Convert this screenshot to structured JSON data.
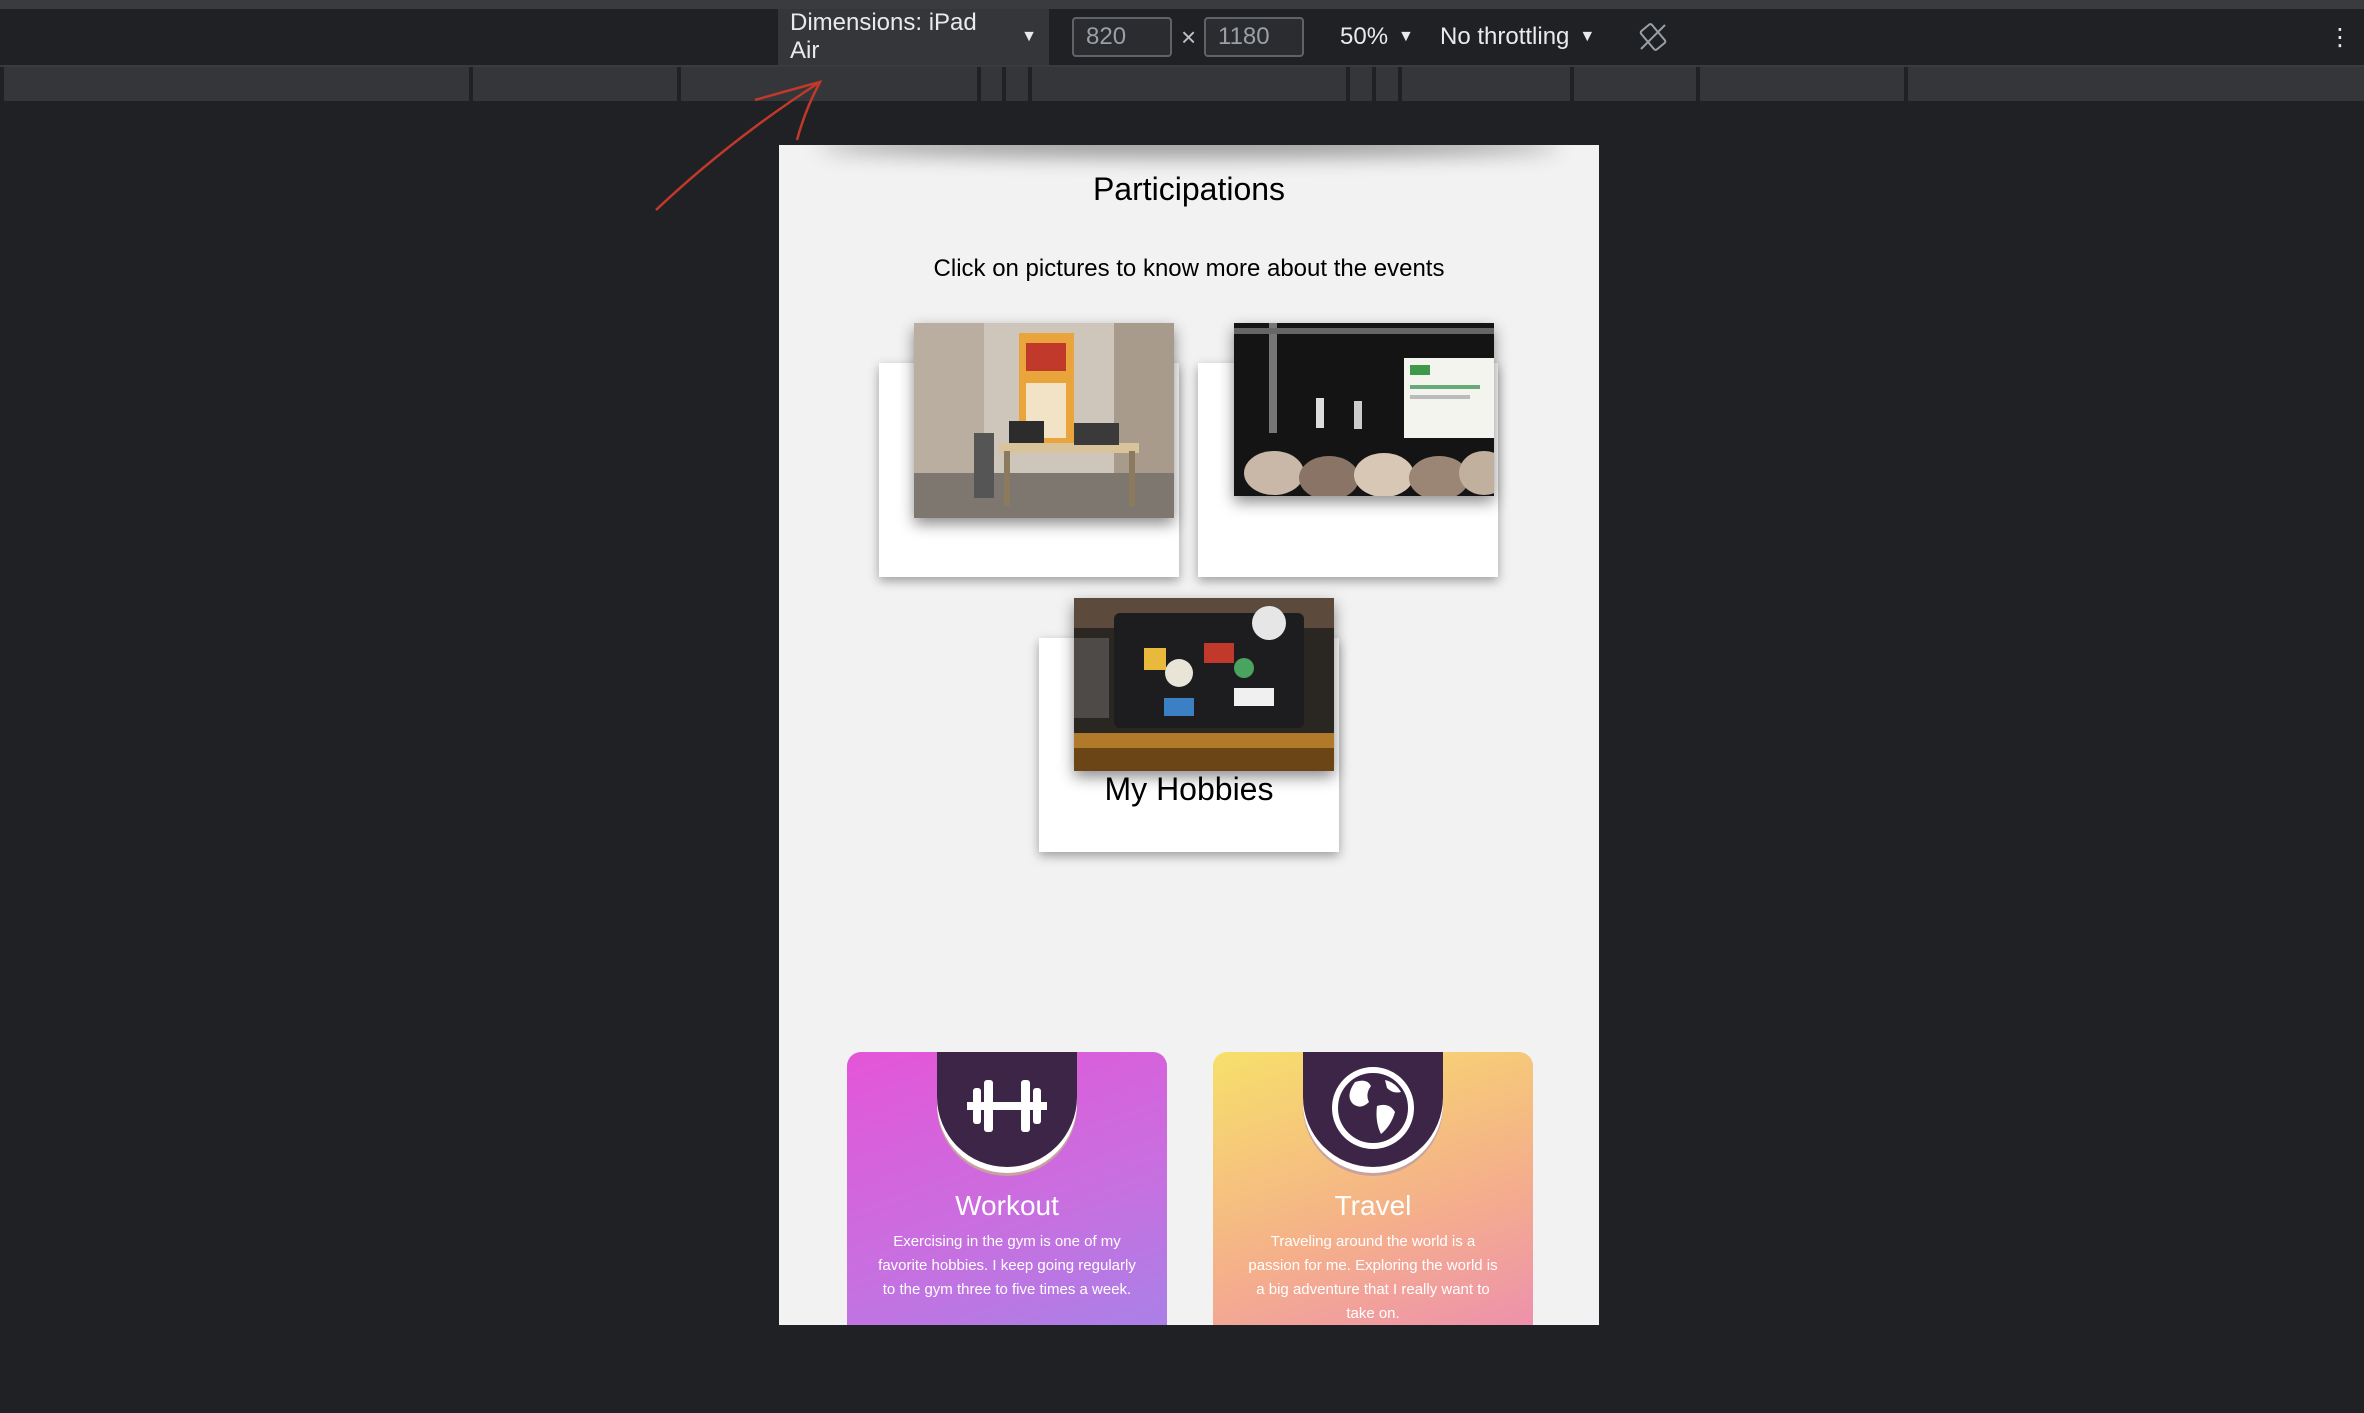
{
  "toolbar": {
    "device_label": "Dimensions: iPad Air",
    "width_value": "820",
    "height_value": "1180",
    "times_symbol": "×",
    "zoom_label": "50%",
    "throttling_label": "No throttling",
    "caret": "▼",
    "kebab": "⋮"
  },
  "page": {
    "participations_title": "Participations",
    "participations_subtitle": "Click on pictures to know more about the events",
    "hobbies_title": "My Hobbies",
    "hobbies": [
      {
        "title": "Workout",
        "icon": "dumbbell-icon",
        "text": "Exercising in the gym is one of my favorite hobbies. I keep going regularly to the gym three to five times a week."
      },
      {
        "title": "Travel",
        "icon": "globe-icon",
        "text": "Traveling around the world is a passion for me. Exploring the world is a big adventure that I really want to take on."
      }
    ]
  },
  "colors": {
    "devtools_bg": "#202124",
    "page_bg": "#f2f2f2",
    "annotation": "#c0392b",
    "workout_gradient": [
      "#e455d8",
      "#a583e8"
    ],
    "travel_gradient": [
      "#f6e06a",
      "#ec8cb2"
    ]
  }
}
